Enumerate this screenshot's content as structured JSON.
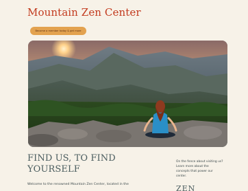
{
  "header": {
    "site_title": "Mountain Zen Center",
    "nav_button_label": "Become a member today & get more"
  },
  "hero": {
    "image_alt": "Woman meditating on rocks facing mountains at sunset"
  },
  "main": {
    "headline_line1": "FIND US, TO FIND",
    "headline_line2": "YOURSELF",
    "welcome_text": "Welcome to the renowned Mountain Zen Center, located in the"
  },
  "sidebar": {
    "note_lines": [
      "On the fence about visiting us?",
      "Learn more about the",
      "concepts that power our",
      "center."
    ],
    "heading": "ZEN"
  },
  "colors": {
    "background": "#f7f2e8",
    "brand": "#c23a1e",
    "accent": "#e3a24f",
    "heading_text": "#4a5c5e"
  }
}
